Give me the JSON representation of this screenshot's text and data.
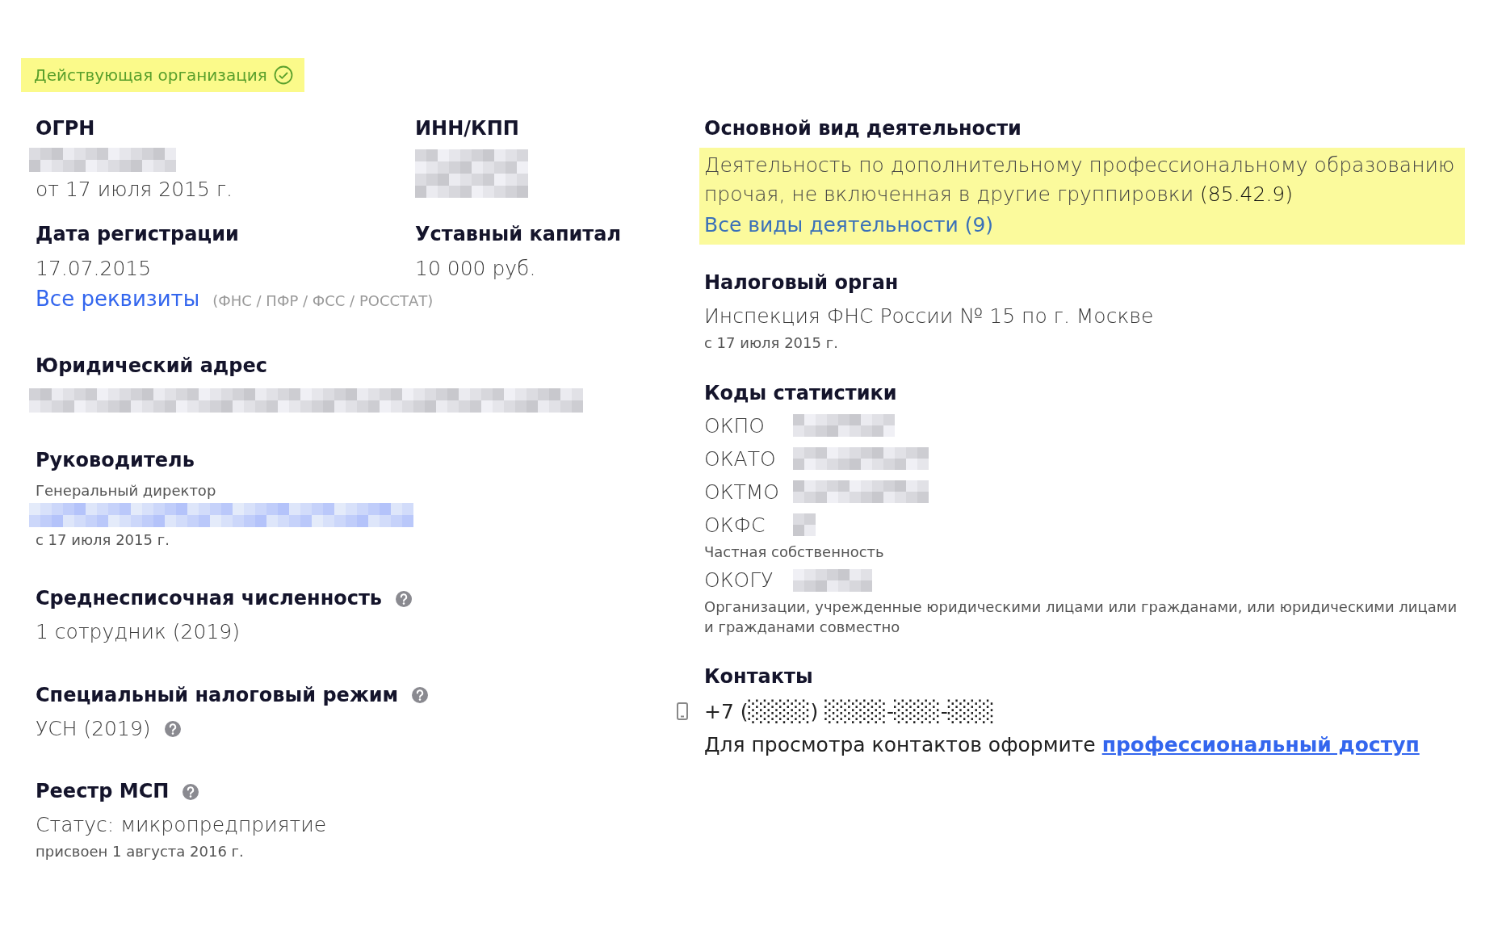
{
  "status_badge": {
    "text": "Действующая организация",
    "active": true
  },
  "left": {
    "ogrn": {
      "label": "ОГРН",
      "date": "от 17 июля 2015 г."
    },
    "inn_kpp": {
      "label": "ИНН/КПП"
    },
    "reg_date": {
      "label": "Дата регистрации",
      "value": "17.07.2015"
    },
    "capital": {
      "label": "Уставный капитал",
      "value": "10 000 руб."
    },
    "requisites": {
      "link": "Все реквизиты",
      "note": "(ФНС / ПФР / ФСС / РОССТАТ)"
    },
    "legal_address": {
      "label": "Юридический адрес"
    },
    "director": {
      "label": "Руководитель",
      "position": "Генеральный директор",
      "since": "с 17 июля 2015 г."
    },
    "headcount": {
      "label": "Среднесписочная численность",
      "help": true,
      "value": "1 сотрудник (2019)",
      "value_help": false
    },
    "tax_regime": {
      "label": "Специальный налоговый режим",
      "help": true,
      "value": "УСН (2019)",
      "value_help": true
    },
    "msp": {
      "label": "Реестр МСП",
      "help": true,
      "status": "Статус: микропредприятие",
      "assigned": "присвоен 1 августа 2016 г."
    }
  },
  "right": {
    "activity": {
      "label": "Основной вид деятельности",
      "text": "Деятельность по дополнительному профессиональному образованию прочая, не включенная в другие группировки",
      "code": "(85.42.9)",
      "link": "Все виды деятельности (9)"
    },
    "tax_authority": {
      "label": "Налоговый орган",
      "name": "Инспекция ФНС России № 15 по г. Москве",
      "since": "с 17 июля 2015 г."
    },
    "stat_codes": {
      "label": "Коды статистики",
      "codes": [
        {
          "code": "ОКПО"
        },
        {
          "code": "ОКАТО"
        },
        {
          "code": "ОКТМО"
        },
        {
          "code": "ОКФС",
          "note": "Частная собственность"
        },
        {
          "code": "ОКОГУ",
          "note": "Организации, учрежденные юридическими лицами или гражданами, или юридическими лицами и гражданами совместно"
        }
      ]
    },
    "contacts": {
      "label": "Контакты",
      "phone": "+7 (░░░░) ░░░░-░░░-░░░",
      "access_text": "Для просмотра контактов оформите",
      "access_link": "профессиональный доступ"
    }
  }
}
